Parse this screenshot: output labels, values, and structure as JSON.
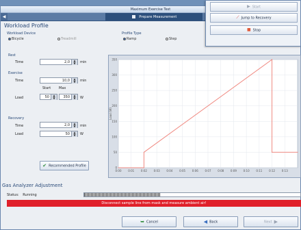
{
  "window": {
    "title": "Maximum Exercise Test"
  },
  "tabs": [
    {
      "label": "",
      "active": false
    },
    {
      "label": "Prepare Measurement",
      "active": true
    },
    {
      "label": "",
      "active": false
    }
  ],
  "workload_profile": {
    "title": "Workload Profile",
    "device_label": "Workload Device",
    "device_options": [
      {
        "label": "Bicycle",
        "selected": true,
        "disabled": false
      },
      {
        "label": "Treadmill",
        "selected": false,
        "disabled": true
      }
    ],
    "profile_type_label": "Profile Type",
    "profile_options": [
      {
        "label": "Ramp",
        "selected": true
      },
      {
        "label": "Step",
        "selected": false
      }
    ],
    "rest": {
      "label": "Rest",
      "time_label": "Time",
      "time_value": "2,0",
      "time_unit": "min"
    },
    "exercise": {
      "label": "Exercise",
      "time_label": "Time",
      "time_value": "10,0",
      "time_unit": "min",
      "start_label": "Start",
      "max_label": "Max",
      "load_label": "Load",
      "load_start": "50",
      "load_max": "350",
      "load_unit": "W"
    },
    "recovery": {
      "label": "Recovery",
      "time_label": "Time",
      "time_value": "2,0",
      "time_unit": "min",
      "load_label": "Load",
      "load_value": "50",
      "load_unit": "W"
    },
    "recommended_button": "Recommended Profile"
  },
  "chart_data": {
    "type": "line",
    "title": "",
    "xlabel": "",
    "ylabel": "Load (W)",
    "x_ticks": [
      "0:00",
      "0:01",
      "0:02",
      "0:03",
      "0:04",
      "0:05",
      "0:06",
      "0:07",
      "0:08",
      "0:09",
      "0:10",
      "0:11",
      "0:12",
      "0:13"
    ],
    "y_ticks": [
      "0",
      "50",
      "100",
      "150",
      "200",
      "250",
      "300",
      "350"
    ],
    "xlim": [
      0,
      14
    ],
    "ylim": [
      0,
      350
    ],
    "series": [
      {
        "name": "",
        "color": "#f08a82",
        "x": [
          0,
          2,
          2,
          12,
          12,
          14
        ],
        "y": [
          0,
          0,
          50,
          350,
          50,
          50
        ]
      }
    ],
    "grid": true
  },
  "gas_analyzer": {
    "title": "Gas Analyzer Adjustment",
    "status_label": "Status:",
    "status_value": "Running",
    "progress": 0.35,
    "warning": "Disconnect sample line from mask and measure ambient air!"
  },
  "footer": {
    "cancel_label": "Cancel",
    "back_label": "Back",
    "next_label": "Next"
  },
  "float_dialog": {
    "start_label": "Start",
    "jump_label": "Jump to Recovery",
    "stop_label": "Stop"
  },
  "colors": {
    "accent": "#2c4f7c",
    "warning": "#e0202a",
    "series": "#f08a82"
  }
}
